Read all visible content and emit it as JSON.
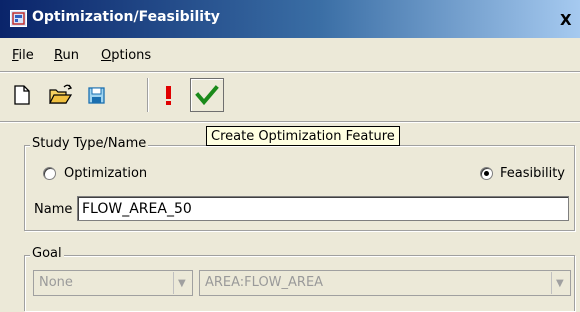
{
  "window": {
    "title": "Optimization/Feasibility",
    "close_glyph": "X"
  },
  "menu": {
    "file": {
      "label": "File",
      "mnemonic": "F",
      "rest": "ile"
    },
    "run": {
      "label": "Run",
      "mnemonic": "R",
      "rest": "un"
    },
    "options": {
      "label": "Options",
      "mnemonic": "O",
      "rest": "ptions"
    }
  },
  "toolbar": {
    "icons": [
      "new-file-icon",
      "open-folder-icon",
      "save-icon",
      "exclamation-icon",
      "checkmark-icon"
    ]
  },
  "tooltip": {
    "text": "Create Optimization Feature"
  },
  "study": {
    "legend": "Study Type/Name",
    "optimization_label": "Optimization",
    "feasibility_label": "Feasibility",
    "selected": "Feasibility",
    "name_label": "Name",
    "name_value": "FLOW_AREA_50"
  },
  "goal": {
    "legend": "Goal",
    "type_value": "None",
    "measure_value": "AREA:FLOW_AREA"
  },
  "colors": {
    "titlebar": "#0a246a",
    "checkmark": "#1a8a1a",
    "exclamation": "#e00000",
    "tooltip_bg": "#ffffe1"
  }
}
